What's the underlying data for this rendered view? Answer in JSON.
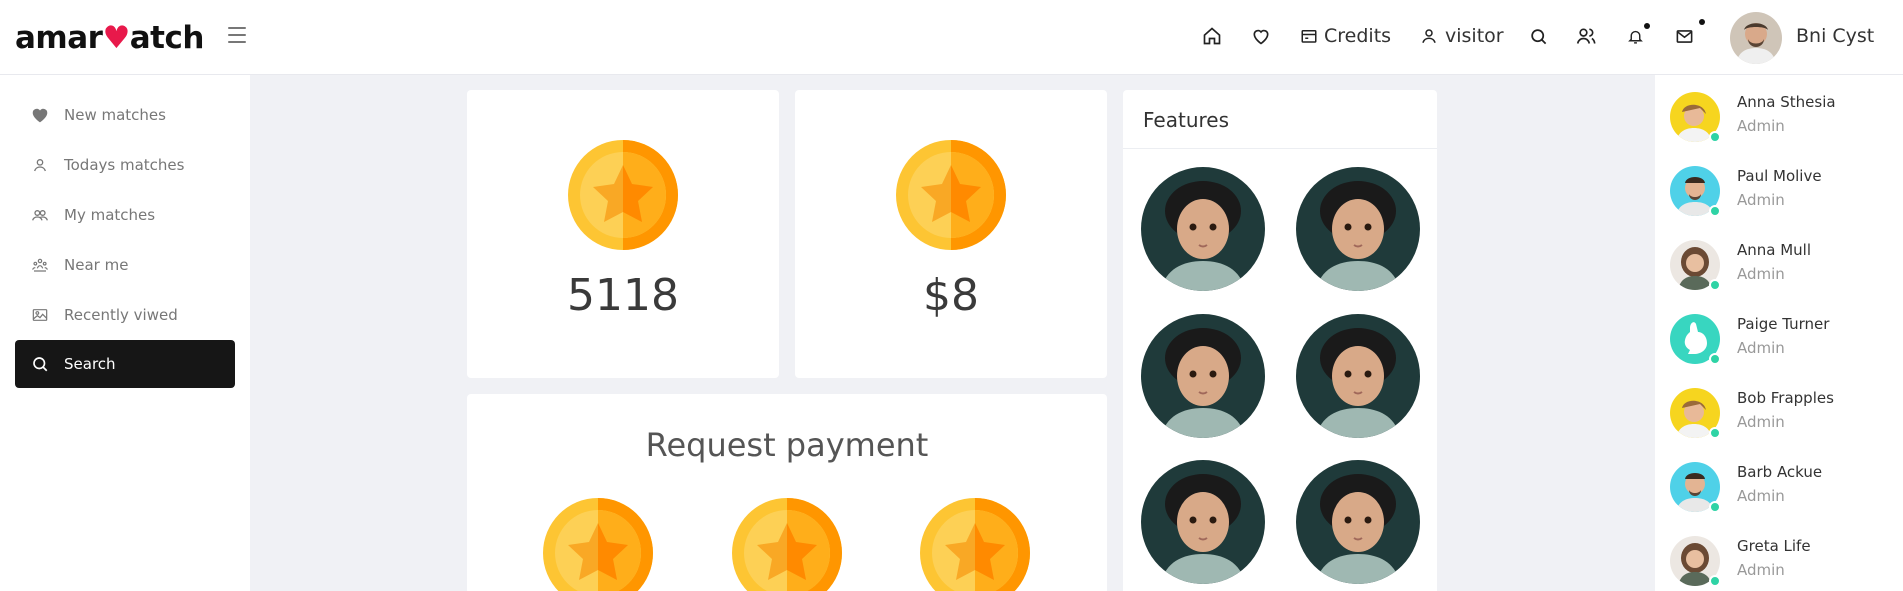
{
  "header": {
    "logo_pre": "amar",
    "logo_heart": "♥",
    "logo_post": "atch",
    "credits_label": "Credits",
    "visitor_label": "visitor",
    "user_name": "Bni Cyst"
  },
  "sidebar": {
    "items": [
      {
        "label": "New matches",
        "icon": "heart-icon"
      },
      {
        "label": "Todays matches",
        "icon": "user-icon"
      },
      {
        "label": "My matches",
        "icon": "users-icon"
      },
      {
        "label": "Near me",
        "icon": "location-people-icon"
      },
      {
        "label": "Recently viwed",
        "icon": "image-icon"
      },
      {
        "label": "Search",
        "icon": "search-icon",
        "active": true
      }
    ]
  },
  "stats": {
    "credits_value": "5118",
    "money_value": "$8"
  },
  "request": {
    "title": "Request payment"
  },
  "features": {
    "title": "Features"
  },
  "users": [
    {
      "name": "Anna Sthesia",
      "role": "Admin"
    },
    {
      "name": "Paul Molive",
      "role": "Admin"
    },
    {
      "name": "Anna Mull",
      "role": "Admin"
    },
    {
      "name": "Paige Turner",
      "role": "Admin"
    },
    {
      "name": "Bob Frapples",
      "role": "Admin"
    },
    {
      "name": "Barb Ackue",
      "role": "Admin"
    },
    {
      "name": "Greta Life",
      "role": "Admin"
    }
  ],
  "colors": {
    "coin_light": "#fdc533",
    "coin_dark": "#ff9600",
    "online": "#2ed3a5",
    "active_bg": "#161616"
  }
}
